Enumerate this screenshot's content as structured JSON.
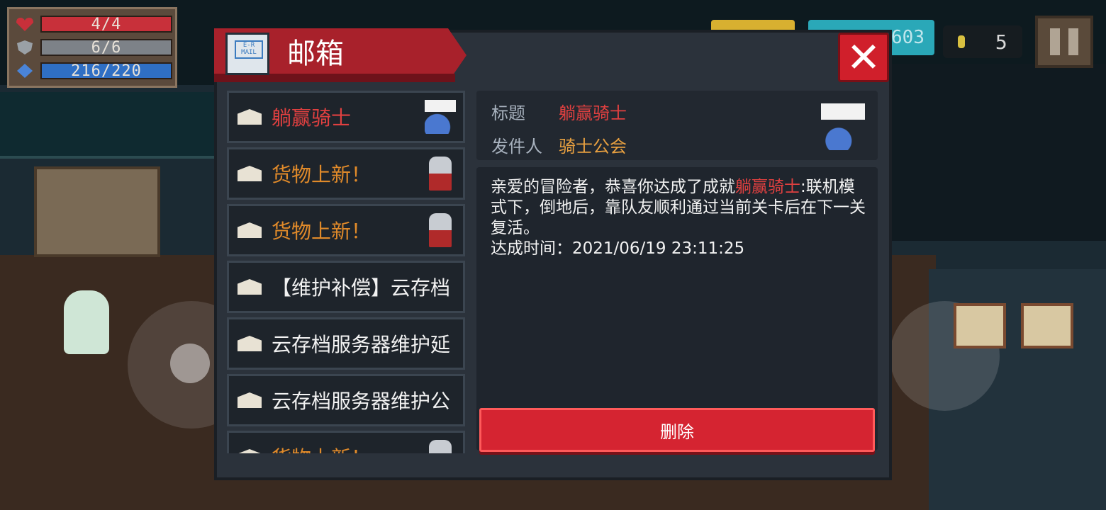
{
  "hud": {
    "hp": "4/4",
    "armor": "6/6",
    "energy": "216/220",
    "hp_fraction": 1.0,
    "armor_fraction": 1.0,
    "energy_fraction": 0.98,
    "gem_count_partial": "603",
    "coins": "5"
  },
  "mailbox": {
    "title": "邮箱",
    "icon_text": "E-R MAIL",
    "items": [
      {
        "label": "躺赢骑士",
        "color": "#e04040",
        "thumb": "sleeping-knight-icon"
      },
      {
        "label": "货物上新！",
        "color": "#e08a2a",
        "thumb": "merchant-icon"
      },
      {
        "label": "货物上新！",
        "color": "#e08a2a",
        "thumb": "merchant-icon"
      },
      {
        "label": "【维护补偿】云存档",
        "color": "#f2f2f2",
        "thumb": ""
      },
      {
        "label": "云存档服务器维护延",
        "color": "#f2f2f2",
        "thumb": ""
      },
      {
        "label": "云存档服务器维护公",
        "color": "#f2f2f2",
        "thumb": ""
      },
      {
        "label": "货物上新！",
        "color": "#e08a2a",
        "thumb": "merchant-icon"
      }
    ],
    "detail": {
      "subject_label": "标题",
      "subject": "躺赢骑士",
      "sender_label": "发件人",
      "sender": "骑士公会",
      "body_pre": "亲爱的冒险者，恭喜你达成了成就",
      "body_highlight": "躺赢骑士",
      "body_post": ":联机模式下，倒地后，靠队友顺利通过当前关卡后在下一关复活。",
      "achieved_time": "达成时间：2021/06/19 23:11:25"
    },
    "delete_label": "删除"
  },
  "colors": {
    "accent_red": "#d01f2b",
    "highlight_red": "#e04040",
    "sender_orange": "#e8a040"
  }
}
